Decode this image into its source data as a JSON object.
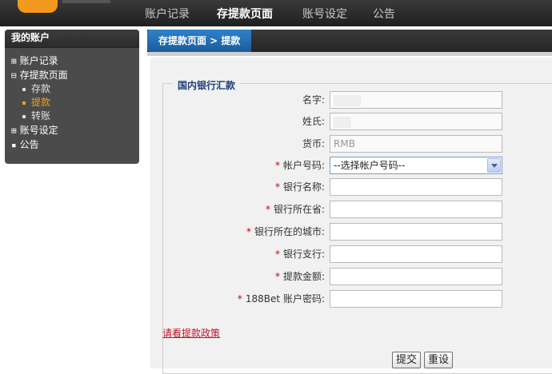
{
  "topnav": {
    "items": [
      {
        "label": "账户记录"
      },
      {
        "label": "存提款页面"
      },
      {
        "label": "账号设定"
      },
      {
        "label": "公告"
      }
    ]
  },
  "sidebar": {
    "title": "我的账户",
    "items": [
      {
        "marker": "⊞",
        "label": "账户记录"
      },
      {
        "marker": "⊟",
        "label": "存提款页面"
      },
      {
        "label": "存款"
      },
      {
        "label": "提款"
      },
      {
        "label": "转账"
      },
      {
        "marker": "⊞",
        "label": "账号设定"
      },
      {
        "marker": "▪",
        "label": "公告"
      }
    ]
  },
  "breadcrumb": {
    "text": "存提款页面 > 提款"
  },
  "form": {
    "legend": "国内银行汇款",
    "first_name_label": "名字:",
    "last_name_label": "姓氏:",
    "currency_label": "货币:",
    "currency_value": "RMB",
    "required_mark": "*",
    "account_label": "帐户号码:",
    "account_selected": "--选择帐户号码--",
    "bank_name_label": "银行名称:",
    "bank_province_label": "银行所在省:",
    "bank_city_label": "银行所在的城市:",
    "bank_branch_label": "银行支行:",
    "amount_label": "提款金额:",
    "password_label": "188Bet 账户密码:",
    "policy_link": "请看提款政策",
    "submit_label": "提交",
    "reset_label": "重设"
  },
  "colors": {
    "accent_blue": "#1b5c9c",
    "active_orange": "#f0a020",
    "required_red": "#cc0000",
    "link_red": "#c0142a"
  }
}
